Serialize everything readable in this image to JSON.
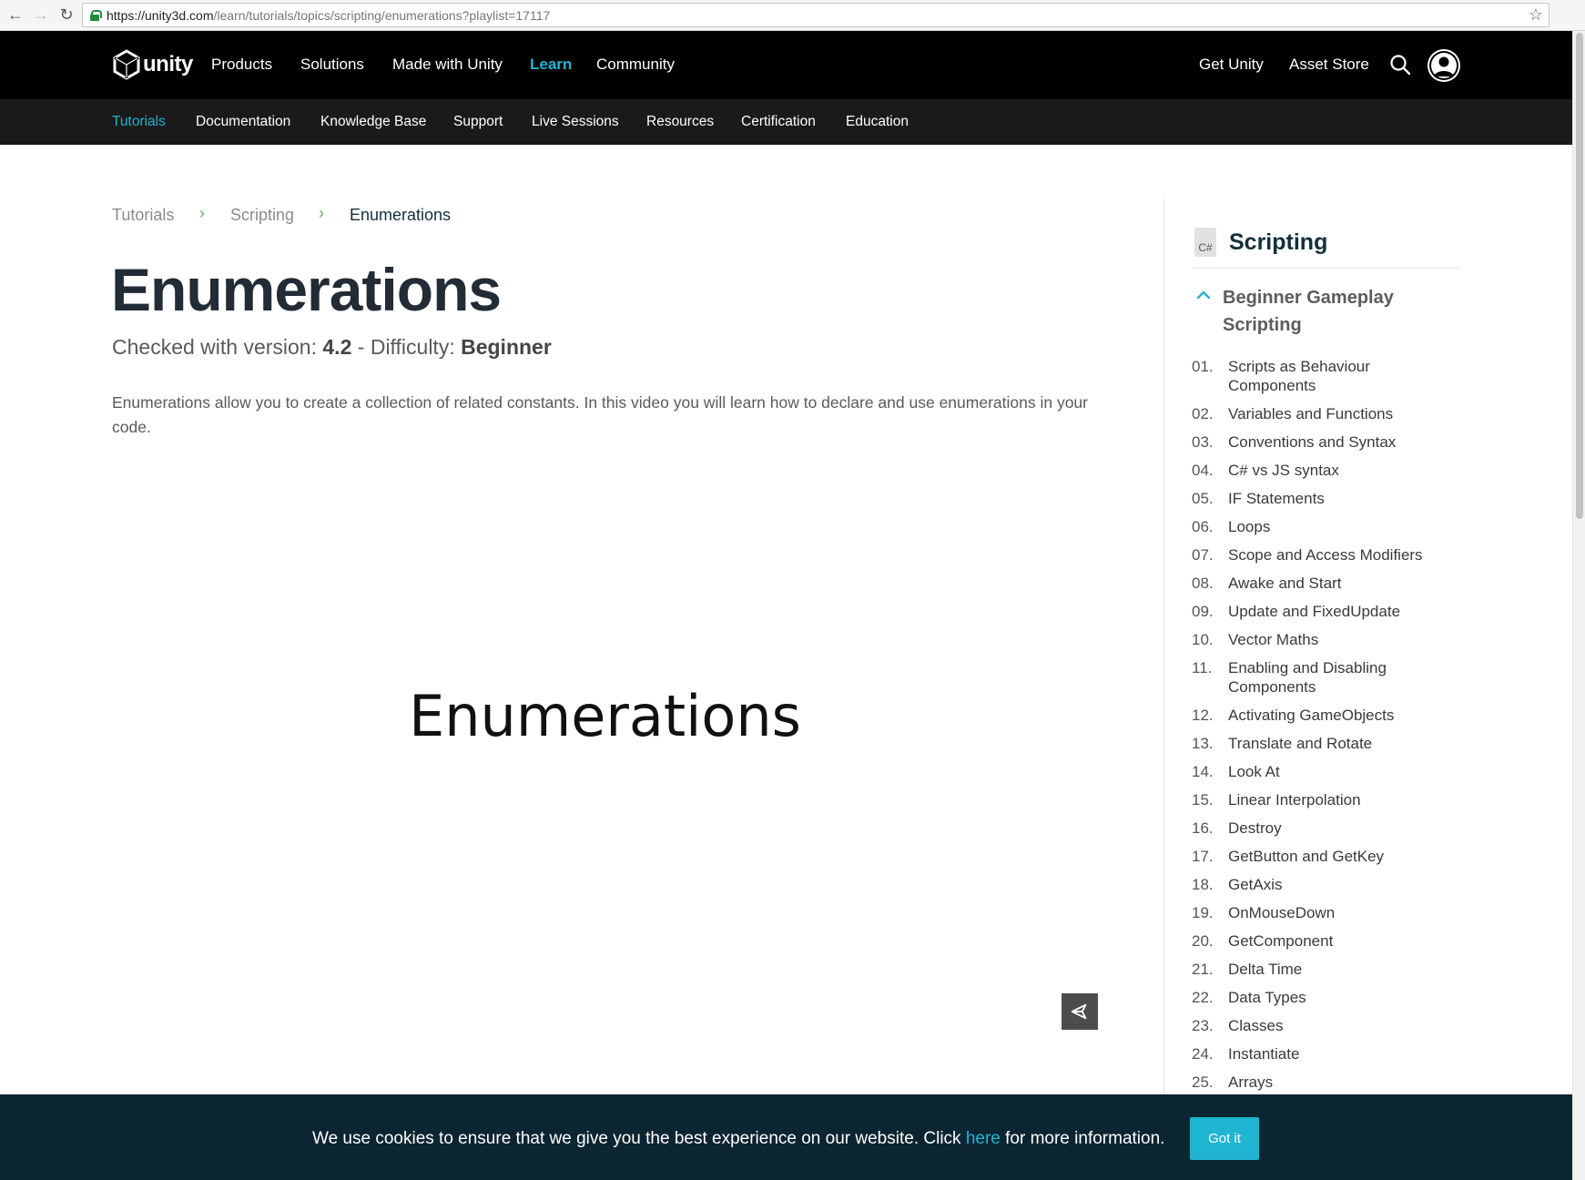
{
  "browser": {
    "url_host": "https://unity3d.com",
    "url_path": "/learn/tutorials/topics/scripting/enumerations?playlist=17117"
  },
  "topnav": {
    "brand": "unity",
    "items": [
      "Products",
      "Solutions",
      "Made with Unity",
      "Learn",
      "Community"
    ],
    "right": [
      "Get Unity",
      "Asset Store"
    ]
  },
  "subnav": {
    "items": [
      "Tutorials",
      "Documentation",
      "Knowledge Base",
      "Support",
      "Live Sessions",
      "Resources",
      "Certification",
      "Education"
    ]
  },
  "breadcrumb": {
    "items": [
      "Tutorials",
      "Scripting",
      "Enumerations"
    ],
    "separator": "›"
  },
  "page": {
    "title": "Enumerations",
    "version_label": "Checked with version: ",
    "version": "4.2",
    "sep": " - ",
    "difficulty_label": "Difficulty: ",
    "difficulty": "Beginner",
    "description": "Enumerations allow you to create a collection of related constants. In this video you will learn how to declare and use enumerations in your code."
  },
  "video": {
    "title": "Enumerations"
  },
  "sidebar": {
    "icon_text": "C#",
    "title": "Scripting",
    "playlist": "Beginner Gameplay Scripting",
    "lessons": [
      {
        "num": "01.",
        "label": "Scripts as Behaviour Components"
      },
      {
        "num": "02.",
        "label": "Variables and Functions"
      },
      {
        "num": "03.",
        "label": "Conventions and Syntax"
      },
      {
        "num": "04.",
        "label": "C# vs JS syntax"
      },
      {
        "num": "05.",
        "label": "IF Statements"
      },
      {
        "num": "06.",
        "label": "Loops"
      },
      {
        "num": "07.",
        "label": "Scope and Access Modifiers"
      },
      {
        "num": "08.",
        "label": "Awake and Start"
      },
      {
        "num": "09.",
        "label": "Update and FixedUpdate"
      },
      {
        "num": "10.",
        "label": "Vector Maths"
      },
      {
        "num": "11.",
        "label": "Enabling and Disabling Components"
      },
      {
        "num": "12.",
        "label": "Activating GameObjects"
      },
      {
        "num": "13.",
        "label": "Translate and Rotate"
      },
      {
        "num": "14.",
        "label": "Look At"
      },
      {
        "num": "15.",
        "label": "Linear Interpolation"
      },
      {
        "num": "16.",
        "label": "Destroy"
      },
      {
        "num": "17.",
        "label": "GetButton and GetKey"
      },
      {
        "num": "18.",
        "label": "GetAxis"
      },
      {
        "num": "19.",
        "label": "OnMouseDown"
      },
      {
        "num": "20.",
        "label": "GetComponent"
      },
      {
        "num": "21.",
        "label": "Delta Time"
      },
      {
        "num": "22.",
        "label": "Data Types"
      },
      {
        "num": "23.",
        "label": "Classes"
      },
      {
        "num": "24.",
        "label": "Instantiate"
      },
      {
        "num": "25.",
        "label": "Arrays"
      }
    ]
  },
  "cookie": {
    "text_before": "We use cookies to ensure that we give you the best experience on our website. Click ",
    "link": "here",
    "text_after": " for more information.",
    "button": "Got it"
  }
}
